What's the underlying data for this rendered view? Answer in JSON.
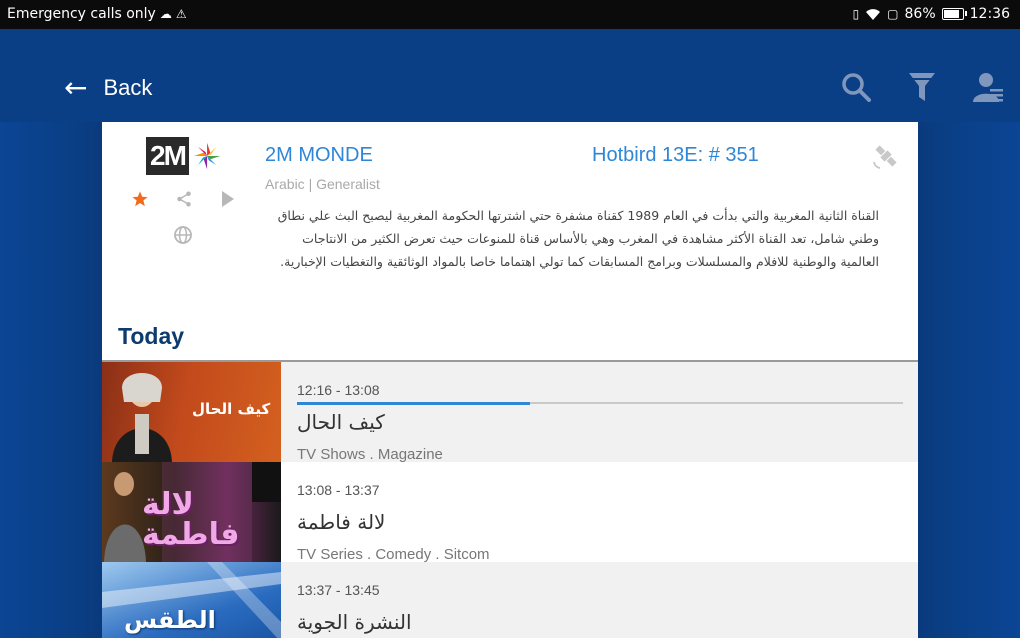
{
  "status_bar": {
    "left_text": "Emergency calls only",
    "battery": "86%",
    "time": "12:36",
    "battery_level": 0.86
  },
  "app_bar": {
    "back_label": "Back",
    "icons": [
      "search-icon",
      "filter-icon",
      "profile-icon"
    ]
  },
  "channel": {
    "logo_text": "2M",
    "name": "2M MONDE",
    "satellite": "Hotbird 13E: # 351",
    "meta": "Arabic | Generalist",
    "description": "القناة الثانية المغربية والتي بدأت في العام 1989 كقناة مشفرة حتي اشترتها الحكومة المغربية ليصبح البث علي نطاق وطني شامل، تعد القناة الأكثر مشاهدة في المغرب وهي بالأساس قناة للمنوعات حيث تعرض الكثير من الانتاجات العالمية والوطنية للافلام والمسلسلات وبرامج المسابقات كما تولي اهتماما خاصا بالمواد الوثائقية والتغطيات الإخبارية.",
    "favorite_color": "#f26b1d"
  },
  "schedule": {
    "section_title": "Today",
    "items": [
      {
        "time": "12:16 - 13:08",
        "title": "كيف الحال",
        "genre": "TV Shows . Magazine",
        "thumb_text": "كيف الحال",
        "progress": 0.385,
        "current": true
      },
      {
        "time": "13:08 - 13:37",
        "title": "لالة فاطمة",
        "genre": "TV Series . Comedy . Sitcom",
        "thumb_text": "لالة فاطمة",
        "current": false
      },
      {
        "time": "13:37 - 13:45",
        "title": "النشرة الجوية",
        "genre": "",
        "thumb_text": "الطقس",
        "current": false
      }
    ]
  },
  "colors": {
    "accent": "#2f86d6",
    "app_bar": "#0a3f86",
    "current_row_bg": "#f1f1f1"
  }
}
